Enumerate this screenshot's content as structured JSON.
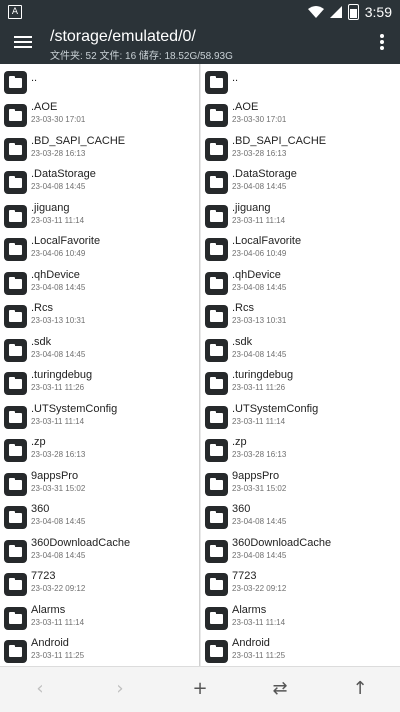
{
  "status_bar": {
    "time": "3:59"
  },
  "app_bar": {
    "path": "/storage/emulated/0/",
    "stats": "文件夹: 52  文件: 16  储存: 18.52G/58.93G"
  },
  "icons": {
    "menu": "hamburger-icon",
    "more": "kebab-menu-icon",
    "back": "chevron-left-icon",
    "forward": "chevron-right-icon",
    "add": "plus-icon",
    "swap": "swap-arrows-icon",
    "up": "arrow-up-icon",
    "folder": "folder-icon"
  },
  "left_pane": {
    "updir": "..",
    "items": [
      {
        "name": ".AOE",
        "date": "23-03-30 17:01"
      },
      {
        "name": ".BD_SAPI_CACHE",
        "date": "23-03-28 16:13"
      },
      {
        "name": ".DataStorage",
        "date": "23-04-08 14:45"
      },
      {
        "name": ".jiguang",
        "date": "23-03-11 11:14"
      },
      {
        "name": ".LocalFavorite",
        "date": "23-04-06 10:49"
      },
      {
        "name": ".qhDevice",
        "date": "23-04-08 14:45"
      },
      {
        "name": ".Rcs",
        "date": "23-03-13 10:31"
      },
      {
        "name": ".sdk",
        "date": "23-04-08 14:45"
      },
      {
        "name": ".turingdebug",
        "date": "23-03-11 11:26"
      },
      {
        "name": ".UTSystemConfig",
        "date": "23-03-11 11:14"
      },
      {
        "name": ".zp",
        "date": "23-03-28 16:13"
      },
      {
        "name": "9appsPro",
        "date": "23-03-31 15:02"
      },
      {
        "name": "360",
        "date": "23-04-08 14:45"
      },
      {
        "name": "360DownloadCache",
        "date": "23-04-08 14:45"
      },
      {
        "name": "7723",
        "date": "23-03-22 09:12"
      },
      {
        "name": "Alarms",
        "date": "23-03-11 11:14"
      },
      {
        "name": "Android",
        "date": "23-03-11 11:25"
      }
    ]
  },
  "right_pane": {
    "updir": "..",
    "items": [
      {
        "name": ".AOE",
        "date": "23-03-30 17:01"
      },
      {
        "name": ".BD_SAPI_CACHE",
        "date": "23-03-28 16:13"
      },
      {
        "name": ".DataStorage",
        "date": "23-04-08 14:45"
      },
      {
        "name": ".jiguang",
        "date": "23-03-11 11:14"
      },
      {
        "name": ".LocalFavorite",
        "date": "23-04-06 10:49"
      },
      {
        "name": ".qhDevice",
        "date": "23-04-08 14:45"
      },
      {
        "name": ".Rcs",
        "date": "23-03-13 10:31"
      },
      {
        "name": ".sdk",
        "date": "23-04-08 14:45"
      },
      {
        "name": ".turingdebug",
        "date": "23-03-11 11:26"
      },
      {
        "name": ".UTSystemConfig",
        "date": "23-03-11 11:14"
      },
      {
        "name": ".zp",
        "date": "23-03-28 16:13"
      },
      {
        "name": "9appsPro",
        "date": "23-03-31 15:02"
      },
      {
        "name": "360",
        "date": "23-04-08 14:45"
      },
      {
        "name": "360DownloadCache",
        "date": "23-04-08 14:45"
      },
      {
        "name": "7723",
        "date": "23-03-22 09:12"
      },
      {
        "name": "Alarms",
        "date": "23-03-11 11:14"
      },
      {
        "name": "Android",
        "date": "23-03-11 11:25"
      }
    ]
  },
  "colors": {
    "toolbar": "#2b3338",
    "folder_icon": "#26292b",
    "bottom_bar": "#f4f4f4"
  }
}
